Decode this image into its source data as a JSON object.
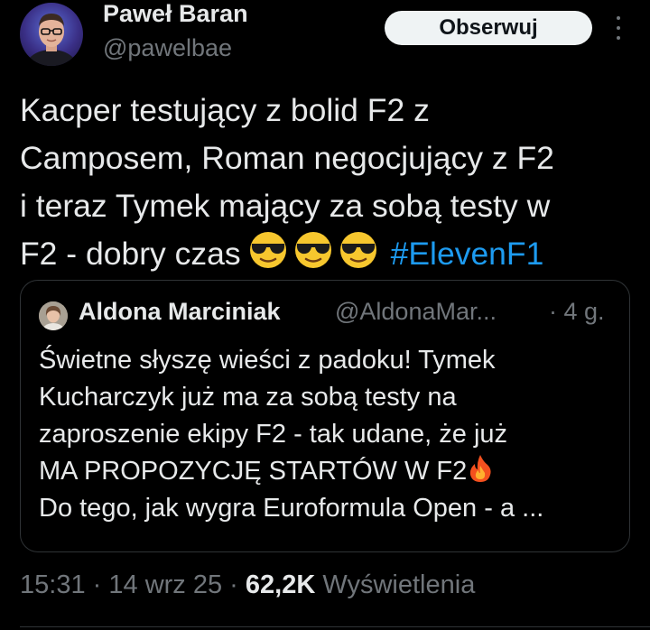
{
  "author": {
    "display_name": "Paweł Baran",
    "handle": "@pawelbae",
    "avatar_icon": "avatar-photo"
  },
  "follow_button_label": "Obserwuj",
  "more_icon": "more-vertical-icon",
  "tweet": {
    "lines": [
      "Kacper testujący z bolid F2 z",
      "Camposem, Roman negocjujący z F2",
      "i teraz Tymek mający za sobą testy w",
      "F2 - dobry czas"
    ],
    "emojis": [
      "sunglasses-face-emoji",
      "sunglasses-face-emoji",
      "sunglasses-face-emoji"
    ],
    "hashtag": "#ElevenF1"
  },
  "quoted_tweet": {
    "display_name": "Aldona Marciniak",
    "handle": "@AldonaMar...",
    "time": "· 4 g.",
    "lines": [
      "Świetne słyszę wieści z padoku! Tymek",
      "Kucharczyk już ma za sobą testy na",
      "zaproszenie ekipy F2 - tak udane, że już",
      "MA PROPOZYCJĘ STARTÓW W F2",
      "Do tego, jak wygra Euroformula Open - a ..."
    ],
    "fire_emoji": "fire-emoji"
  },
  "meta": {
    "time": "15:31",
    "date": "14 wrz 25",
    "views_count": "62,2K",
    "views_label": "Wyświetlenia",
    "separator": "·"
  },
  "colors": {
    "background": "#000000",
    "text": "#e7e9ea",
    "secondary": "#71767b",
    "link": "#1d9bf0",
    "border": "#2f3336",
    "button_bg": "#eff3f4"
  }
}
